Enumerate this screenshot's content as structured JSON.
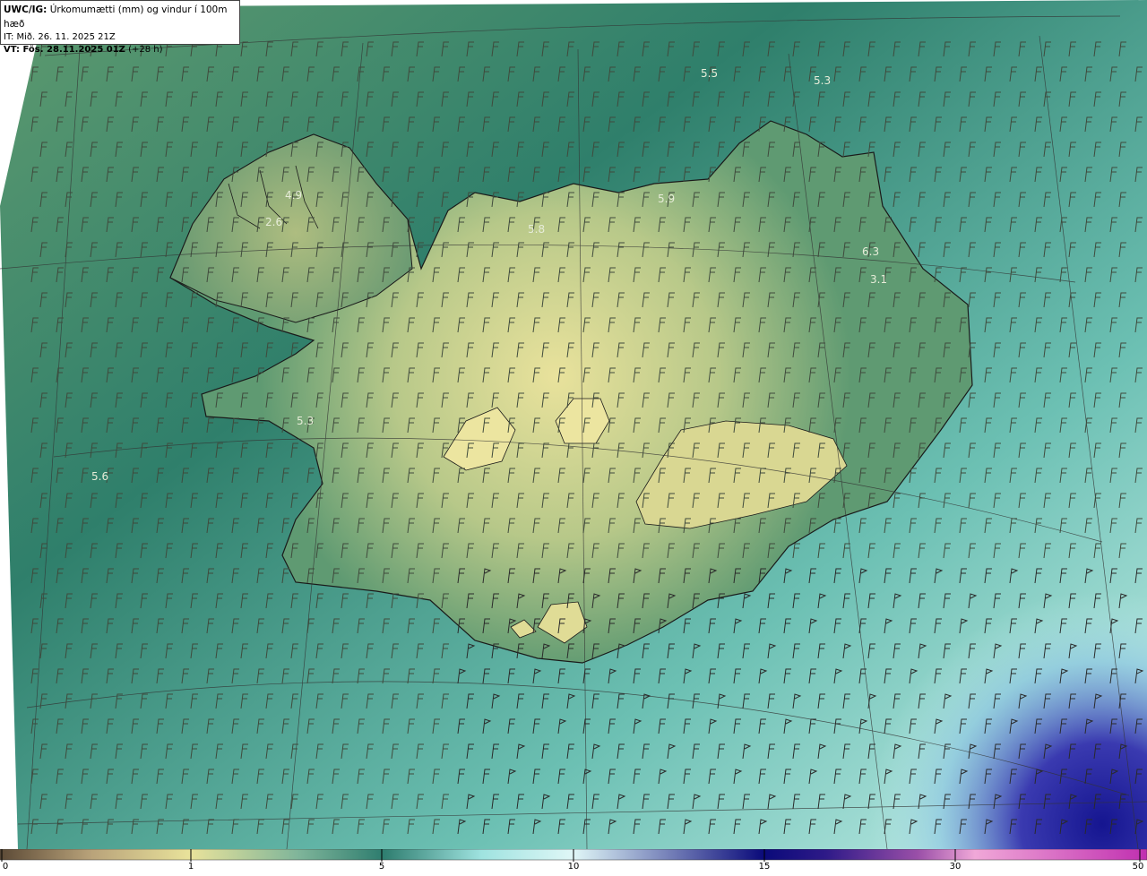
{
  "header": {
    "model_label": "UWC/IG:",
    "title": "Úrkomumætti (mm) og vindur í 100m hæð",
    "init_time": "IT: Mið. 26. 11. 2025 21Z",
    "valid_label": "VT: Fös. 28.11.2025 01Z",
    "lead": "(+28 h)"
  },
  "station_values": [
    "5.5",
    "5.3",
    "4.9",
    "2.6",
    "5.8",
    "5.9",
    "6.3",
    "3.1",
    "5.3",
    "5.6"
  ],
  "colorbar": {
    "ticks": [
      "0",
      "1",
      "5",
      "10",
      "15",
      "30",
      "50"
    ],
    "colors": [
      "#5c4a36",
      "#b9a37a",
      "#e9e39b",
      "#7fb59a",
      "#2e7d6f",
      "#9fe3e0",
      "#e0f7f7",
      "#0a0a7a",
      "#2e1a88",
      "#9a4fa8",
      "#f0a8d8",
      "#c02fb0"
    ]
  },
  "colors": {
    "sea_dark": "#2f7f6b",
    "sea_light": "#a8e6e2",
    "land_low": "#6ca47a",
    "land_high": "#e7e09a",
    "heavy_precip": "#1a1a8c",
    "coast": "#1a1a1a",
    "grid": "#333333"
  }
}
